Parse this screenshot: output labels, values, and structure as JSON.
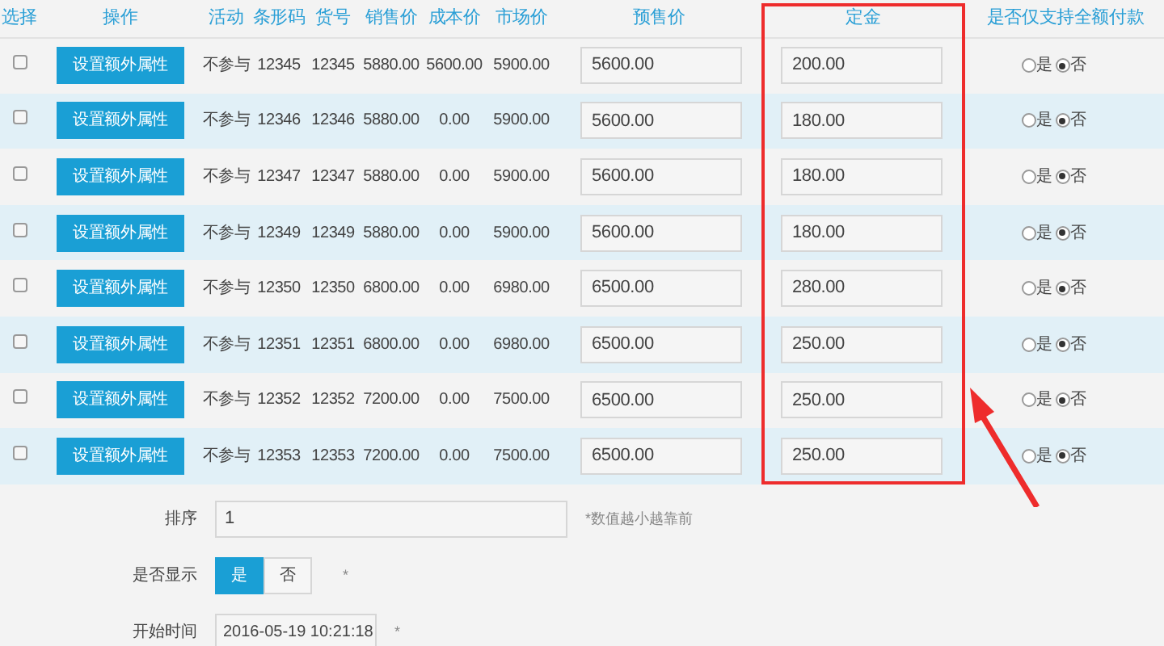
{
  "table": {
    "columns": [
      "选择",
      "操作",
      "活动",
      "条形码",
      "货号",
      "销售价",
      "成本价",
      "市场价",
      "预售价",
      "定金",
      "是否仅支持全额付款"
    ],
    "rows": [
      {
        "checked": false,
        "action": "设置额外属性",
        "activity": "不参与",
        "barcode": "12345",
        "sku": "12345",
        "sale_price": "5880.00",
        "cost_price": "5600.00",
        "market_price": "5900.00",
        "presale_price": "5600.00",
        "deposit": "200.00",
        "full_payment_only": false,
        "radio_labels": [
          "是",
          "否"
        ]
      },
      {
        "checked": false,
        "action": "设置额外属性",
        "activity": "不参与",
        "barcode": "12346",
        "sku": "12346",
        "sale_price": "5880.00",
        "cost_price": "0.00",
        "market_price": "5900.00",
        "presale_price": "5600.00",
        "deposit": "180.00",
        "full_payment_only": false,
        "radio_labels": [
          "是",
          "否"
        ]
      },
      {
        "checked": false,
        "action": "设置额外属性",
        "activity": "不参与",
        "barcode": "12347",
        "sku": "12347",
        "sale_price": "5880.00",
        "cost_price": "0.00",
        "market_price": "5900.00",
        "presale_price": "5600.00",
        "deposit": "180.00",
        "full_payment_only": false,
        "radio_labels": [
          "是",
          "否"
        ]
      },
      {
        "checked": false,
        "action": "设置额外属性",
        "activity": "不参与",
        "barcode": "12349",
        "sku": "12349",
        "sale_price": "5880.00",
        "cost_price": "0.00",
        "market_price": "5900.00",
        "presale_price": "5600.00",
        "deposit": "180.00",
        "full_payment_only": false,
        "radio_labels": [
          "是",
          "否"
        ]
      },
      {
        "checked": false,
        "action": "设置额外属性",
        "activity": "不参与",
        "barcode": "12350",
        "sku": "12350",
        "sale_price": "6800.00",
        "cost_price": "0.00",
        "market_price": "6980.00",
        "presale_price": "6500.00",
        "deposit": "280.00",
        "full_payment_only": false,
        "radio_labels": [
          "是",
          "否"
        ]
      },
      {
        "checked": false,
        "action": "设置额外属性",
        "activity": "不参与",
        "barcode": "12351",
        "sku": "12351",
        "sale_price": "6800.00",
        "cost_price": "0.00",
        "market_price": "6980.00",
        "presale_price": "6500.00",
        "deposit": "250.00",
        "full_payment_only": false,
        "radio_labels": [
          "是",
          "否"
        ]
      },
      {
        "checked": false,
        "action": "设置额外属性",
        "activity": "不参与",
        "barcode": "12352",
        "sku": "12352",
        "sale_price": "7200.00",
        "cost_price": "0.00",
        "market_price": "7500.00",
        "presale_price": "6500.00",
        "deposit": "250.00",
        "full_payment_only": false,
        "radio_labels": [
          "是",
          "否"
        ]
      },
      {
        "checked": false,
        "action": "设置额外属性",
        "activity": "不参与",
        "barcode": "12353",
        "sku": "12353",
        "sale_price": "7200.00",
        "cost_price": "0.00",
        "market_price": "7500.00",
        "presale_price": "6500.00",
        "deposit": "250.00",
        "full_payment_only": false,
        "radio_labels": [
          "是",
          "否"
        ]
      }
    ]
  },
  "form": {
    "sort": {
      "label": "排序",
      "value": "1",
      "hint": "*数值越小越靠前"
    },
    "display": {
      "label": "是否显示",
      "options": [
        {
          "label": "是",
          "selected": true
        },
        {
          "label": "否",
          "selected": false
        }
      ],
      "required": "*"
    },
    "start_time": {
      "label": "开始时间",
      "value": "2016-05-19 10:21:18",
      "required": "*"
    }
  }
}
